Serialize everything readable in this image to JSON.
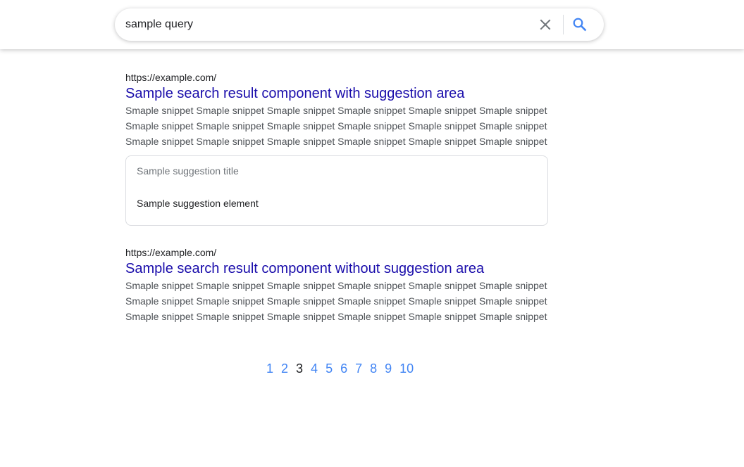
{
  "search": {
    "query": "sample query",
    "placeholder": ""
  },
  "icons": {
    "clear": "close-icon",
    "search": "search-icon"
  },
  "colors": {
    "accent": "#4285f4",
    "title_link": "#1a0dab",
    "snippet": "#4d5156"
  },
  "results": [
    {
      "url": "https://example.com/",
      "title": "Sample search result component with suggestion area",
      "snippet_lines": [
        "Smaple snippet Smaple snippet Smaple snippet Smaple snippet Smaple snippet Smaple snippet",
        "Smaple snippet Smaple snippet Smaple snippet Smaple snippet Smaple snippet Smaple snippet",
        "Smaple snippet Smaple snippet Smaple snippet Smaple snippet Smaple snippet Smaple snippet"
      ],
      "suggestion": {
        "title": "Sample suggestion title",
        "element": "Sample suggestion element"
      }
    },
    {
      "url": "https://example.com/",
      "title": "Sample search result component without suggestion area",
      "snippet_lines": [
        "Smaple snippet Smaple snippet Smaple snippet Smaple snippet Smaple snippet Smaple snippet",
        "Smaple snippet Smaple snippet Smaple snippet Smaple snippet Smaple snippet Smaple snippet",
        "Smaple snippet Smaple snippet Smaple snippet Smaple snippet Smaple snippet Smaple snippet"
      ]
    }
  ],
  "pagination": {
    "pages": [
      "1",
      "2",
      "3",
      "4",
      "5",
      "6",
      "7",
      "8",
      "9",
      "10"
    ],
    "current": "3"
  }
}
